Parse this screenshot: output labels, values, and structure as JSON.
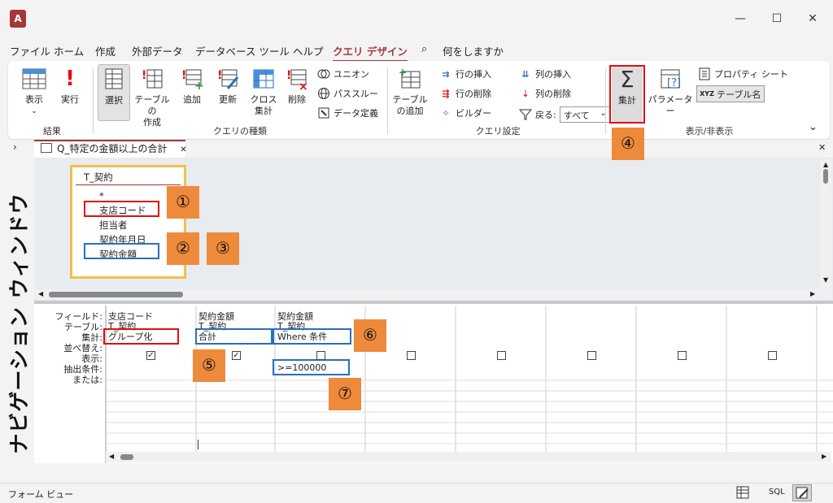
{
  "window": {
    "app_icon": "A",
    "controls": {
      "minimize": "—",
      "maximize": "☐",
      "close": "✕"
    }
  },
  "menu": {
    "items": [
      "ファイル",
      "ホーム",
      "作成",
      "外部データ",
      "データベース ツール",
      "ヘルプ",
      "クエリ デザイン"
    ],
    "search": "何をしますか"
  },
  "ribbon": {
    "results": {
      "view": "表示",
      "run": "実行",
      "label": "結果"
    },
    "query_type": {
      "select": "選択",
      "make_table_1": "テーブルの",
      "make_table_2": "作成",
      "append": "追加",
      "update": "更新",
      "crosstab_1": "クロス",
      "crosstab_2": "集計",
      "delete": "削除",
      "union": "ユニオン",
      "passthrough": "パススルー",
      "data_definition": "データ定義",
      "label": "クエリの種類"
    },
    "query_setup": {
      "add_table_1": "テーブル",
      "add_table_2": "の追加",
      "insert_rows": "行の挿入",
      "delete_rows": "行の削除",
      "builder": "ビルダー",
      "insert_columns": "列の挿入",
      "delete_columns": "列の削除",
      "return_label": "戻る:",
      "return_value": "すべて",
      "label": "クエリ設定"
    },
    "show_hide": {
      "totals": "集計",
      "parameters": "パラメーター",
      "property_sheet": "プロパティ シート",
      "table_names": "テーブル名",
      "label": "表示/非表示"
    }
  },
  "tab": {
    "title": "Q_特定の金額以上の合計",
    "close": "✕"
  },
  "nav_pane_label": "ナビゲーション ウィンドウ",
  "table_box": {
    "title": "T_契約",
    "fields": [
      "*",
      "支店コード",
      "担当者",
      "契約年月日",
      "契約金額"
    ]
  },
  "grid": {
    "row_labels": [
      "フィールド:",
      "テーブル:",
      "集計:",
      "並べ替え:",
      "表示:",
      "抽出条件:",
      "または:"
    ],
    "columns": [
      {
        "field": "支店コード",
        "table": "T_契約",
        "total": "グループ化",
        "criteria": ""
      },
      {
        "field": "契約金額",
        "table": "T_契約",
        "total": "合計",
        "criteria": ""
      },
      {
        "field": "契約金額",
        "table": "T_契約",
        "total": "Where 条件",
        "criteria": ">=100000"
      }
    ],
    "show_checked": [
      true,
      true,
      false,
      false,
      false,
      false,
      false,
      false
    ]
  },
  "callouts": [
    "①",
    "②",
    "③",
    "④",
    "⑤",
    "⑥",
    "⑦"
  ],
  "status": {
    "left": "フォーム ビュー",
    "sql": "SQL"
  },
  "colors": {
    "accent": "#a4373a",
    "callout": "#ee8a3c",
    "red_box": "#e01010",
    "blue_box": "#2a6fbd"
  }
}
